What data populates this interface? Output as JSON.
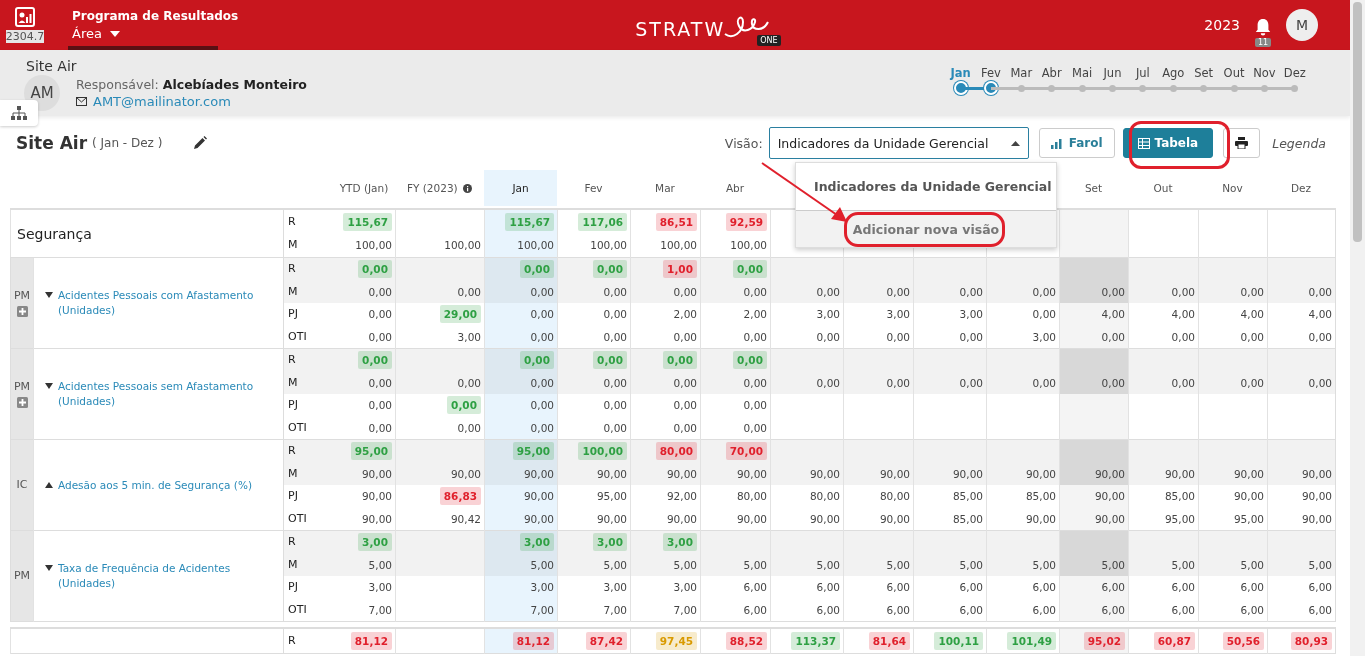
{
  "app_bar": {
    "badge_code": "2304.7",
    "program": "Programa de Resultados",
    "area": "Área",
    "logo_text": "STRATW",
    "logo_suffix": "ONE",
    "year": "2023",
    "notifications": "11",
    "user_initial": "M"
  },
  "unit": {
    "name": "Site Air",
    "initials": "AM",
    "responsible_label": "Responsável:",
    "responsible": "Alcebíades Monteiro",
    "email": "AMT@mailinator.com"
  },
  "months": [
    {
      "label": "Jan",
      "selected": true,
      "in_range": true
    },
    {
      "label": "Fev",
      "selected": false,
      "in_range": true
    },
    {
      "label": "Mar",
      "selected": false,
      "in_range": false
    },
    {
      "label": "Abr",
      "selected": false,
      "in_range": false
    },
    {
      "label": "Mai",
      "selected": false,
      "in_range": false
    },
    {
      "label": "Jun",
      "selected": false,
      "in_range": false
    },
    {
      "label": "Jul",
      "selected": false,
      "in_range": false
    },
    {
      "label": "Ago",
      "selected": false,
      "in_range": false
    },
    {
      "label": "Set",
      "selected": false,
      "in_range": false
    },
    {
      "label": "Out",
      "selected": false,
      "in_range": false
    },
    {
      "label": "Nov",
      "selected": false,
      "in_range": false
    },
    {
      "label": "Dez",
      "selected": false,
      "in_range": false
    }
  ],
  "title": {
    "name": "Site Air",
    "period": "( Jan - Dez )"
  },
  "toolbar": {
    "view_label": "Visão:",
    "view_value": "Indicadores da Unidade Gerencial",
    "buttons": [
      {
        "label": "Farol",
        "selected": false
      },
      {
        "label": "Tabela",
        "selected": true
      }
    ],
    "legend": "Legenda"
  },
  "view_menu": {
    "options": [
      "Indicadores da Unidade Gerencial"
    ],
    "add_option": "Adicionar nova visão"
  },
  "columns": [
    {
      "label": "YTD (Jan)",
      "selected": false,
      "shaded": false,
      "info": false
    },
    {
      "label": "FY (2023)",
      "selected": false,
      "shaded": false,
      "info": true
    },
    {
      "label": "Jan",
      "selected": true,
      "shaded": false,
      "info": false
    },
    {
      "label": "Fev",
      "selected": false,
      "shaded": false,
      "info": false
    },
    {
      "label": "Mar",
      "selected": false,
      "shaded": false,
      "info": false
    },
    {
      "label": "Abr",
      "selected": false,
      "shaded": false,
      "info": false
    },
    {
      "shaded": false
    },
    {
      "shaded": false
    },
    {
      "shaded": false
    },
    {
      "shaded": false
    },
    {
      "label": "Set",
      "selected": false,
      "shaded": true,
      "info": false
    },
    {
      "label": "Out",
      "selected": false,
      "shaded": false,
      "info": false
    },
    {
      "label": "Nov",
      "selected": false,
      "shaded": false,
      "info": false
    },
    {
      "label": "Dez",
      "selected": false,
      "shaded": false,
      "info": false
    }
  ],
  "section": {
    "title": "Segurança",
    "rows": [
      {
        "type": "R",
        "shaded": false,
        "cells": [
          {
            "text": "115,67",
            "color": "#2ea043"
          },
          null,
          {
            "text": "115,67",
            "color": "#2ea043"
          },
          {
            "text": "117,06",
            "color": "#2ea043"
          },
          {
            "text": "86,51",
            "color": "#e0202c"
          },
          {
            "text": "92,59",
            "color": "#e0202c"
          },
          null,
          null,
          null,
          null,
          null,
          null,
          null,
          null
        ]
      },
      {
        "type": "M",
        "shaded": false,
        "cells": [
          "100,00",
          "100,00",
          "100,00",
          "100,00",
          "100,00",
          "100,00",
          null,
          null,
          null,
          null,
          null,
          null,
          null,
          null
        ]
      }
    ]
  },
  "indicators": [
    {
      "code": "PM",
      "addable": true,
      "expanded": true,
      "name": "Acidentes Pessoais com Afastamento (Unidades)",
      "rows": [
        {
          "type": "R",
          "shaded": true,
          "cells": [
            {
              "text": "0,00",
              "color": "#2ea043"
            },
            null,
            {
              "text": "0,00",
              "color": "#2ea043"
            },
            {
              "text": "0,00",
              "color": "#2ea043"
            },
            {
              "text": "1,00",
              "color": "#e0202c"
            },
            {
              "text": "0,00",
              "color": "#2ea043"
            },
            null,
            null,
            null,
            null,
            null,
            null,
            null,
            null
          ]
        },
        {
          "type": "M",
          "shaded": true,
          "cells": [
            "0,00",
            "0,00",
            "0,00",
            "0,00",
            "0,00",
            "0,00",
            "0,00",
            "0,00",
            "0,00",
            "0,00",
            "0,00",
            "0,00",
            "0,00",
            "0,00"
          ]
        },
        {
          "type": "PJ",
          "shaded": false,
          "cells": [
            "0,00",
            {
              "text": "29,00",
              "color": "#2ea043"
            },
            "0,00",
            "0,00",
            "2,00",
            "2,00",
            "3,00",
            "3,00",
            "3,00",
            "0,00",
            "4,00",
            "4,00",
            "4,00",
            "4,00"
          ]
        },
        {
          "type": "OTI",
          "shaded": false,
          "cells": [
            "0,00",
            "3,00",
            "0,00",
            "0,00",
            "0,00",
            "0,00",
            "0,00",
            "0,00",
            "0,00",
            "3,00",
            "0,00",
            "0,00",
            "0,00",
            "0,00"
          ]
        }
      ]
    },
    {
      "code": "PM",
      "addable": true,
      "expanded": true,
      "name": "Acidentes Pessoais sem Afastamento (Unidades)",
      "rows": [
        {
          "type": "R",
          "shaded": true,
          "cells": [
            {
              "text": "0,00",
              "color": "#2ea043"
            },
            null,
            {
              "text": "0,00",
              "color": "#2ea043"
            },
            {
              "text": "0,00",
              "color": "#2ea043"
            },
            {
              "text": "0,00",
              "color": "#2ea043"
            },
            {
              "text": "0,00",
              "color": "#2ea043"
            },
            null,
            null,
            null,
            null,
            null,
            null,
            null,
            null
          ]
        },
        {
          "type": "M",
          "shaded": true,
          "cells": [
            "0,00",
            "0,00",
            "0,00",
            "0,00",
            "0,00",
            "0,00",
            "0,00",
            "0,00",
            "0,00",
            "0,00",
            "0,00",
            "0,00",
            "0,00",
            "0,00"
          ]
        },
        {
          "type": "PJ",
          "shaded": false,
          "cells": [
            "0,00",
            {
              "text": "0,00",
              "color": "#2ea043"
            },
            "0,00",
            "0,00",
            "0,00",
            "0,00",
            null,
            null,
            null,
            null,
            null,
            null,
            null,
            null
          ]
        },
        {
          "type": "OTI",
          "shaded": false,
          "cells": [
            "0,00",
            "0,00",
            "0,00",
            "0,00",
            "0,00",
            "0,00",
            null,
            null,
            null,
            null,
            null,
            null,
            null,
            null
          ]
        }
      ]
    },
    {
      "code": "IC",
      "addable": false,
      "expanded": false,
      "name": "Adesão aos 5 min. de Segurança (%)",
      "rows": [
        {
          "type": "R",
          "shaded": true,
          "cells": [
            {
              "text": "95,00",
              "color": "#2ea043"
            },
            null,
            {
              "text": "95,00",
              "color": "#2ea043"
            },
            {
              "text": "100,00",
              "color": "#2ea043"
            },
            {
              "text": "80,00",
              "color": "#e0202c"
            },
            {
              "text": "70,00",
              "color": "#e0202c"
            },
            null,
            null,
            null,
            null,
            null,
            null,
            null,
            null
          ]
        },
        {
          "type": "M",
          "shaded": true,
          "cells": [
            "90,00",
            "90,00",
            "90,00",
            "90,00",
            "90,00",
            "90,00",
            "90,00",
            "90,00",
            "90,00",
            "90,00",
            "90,00",
            "90,00",
            "90,00",
            "90,00"
          ]
        },
        {
          "type": "PJ",
          "shaded": false,
          "cells": [
            "90,00",
            {
              "text": "86,83",
              "color": "#e0202c"
            },
            "90,00",
            "95,00",
            "92,00",
            "80,00",
            "80,00",
            "80,00",
            "85,00",
            "85,00",
            "90,00",
            "85,00",
            "90,00",
            "90,00"
          ]
        },
        {
          "type": "OTI",
          "shaded": false,
          "cells": [
            "90,00",
            "90,42",
            "90,00",
            "90,00",
            "90,00",
            "90,00",
            "90,00",
            "90,00",
            "85,00",
            "90,00",
            "90,00",
            "95,00",
            "95,00",
            "90,00"
          ]
        }
      ]
    },
    {
      "code": "PM",
      "addable": false,
      "expanded": true,
      "name": "Taxa de Frequência de Acidentes (Unidades)",
      "rows": [
        {
          "type": "R",
          "shaded": true,
          "cells": [
            {
              "text": "3,00",
              "color": "#2ea043"
            },
            null,
            {
              "text": "3,00",
              "color": "#2ea043"
            },
            {
              "text": "3,00",
              "color": "#2ea043"
            },
            {
              "text": "3,00",
              "color": "#2ea043"
            },
            null,
            null,
            null,
            null,
            null,
            null,
            null,
            null,
            null
          ]
        },
        {
          "type": "M",
          "shaded": true,
          "cells": [
            "5,00",
            null,
            "5,00",
            "5,00",
            "5,00",
            "5,00",
            "5,00",
            "5,00",
            "5,00",
            "5,00",
            "5,00",
            "5,00",
            "5,00",
            "5,00"
          ]
        },
        {
          "type": "PJ",
          "shaded": false,
          "cells": [
            "3,00",
            null,
            "3,00",
            "3,00",
            "3,00",
            "6,00",
            "6,00",
            "6,00",
            "6,00",
            "6,00",
            "6,00",
            "6,00",
            "6,00",
            "6,00"
          ]
        },
        {
          "type": "OTI",
          "shaded": false,
          "cells": [
            "7,00",
            null,
            "7,00",
            "7,00",
            "7,00",
            "6,00",
            "6,00",
            "6,00",
            "6,00",
            "6,00",
            "6,00",
            "6,00",
            "6,00",
            "6,00"
          ]
        }
      ]
    }
  ],
  "next_section": {
    "rows": [
      {
        "type": "R",
        "shaded": false,
        "cells": [
          {
            "text": "81,12",
            "color": "#e0202c"
          },
          null,
          {
            "text": "81,12",
            "color": "#e0202c"
          },
          {
            "text": "87,42",
            "color": "#e0202c"
          },
          {
            "text": "97,45",
            "color": "#d99a00"
          },
          {
            "text": "88,52",
            "color": "#e0202c"
          },
          {
            "text": "113,37",
            "color": "#2ea043"
          },
          {
            "text": "81,64",
            "color": "#e0202c"
          },
          {
            "text": "100,11",
            "color": "#2ea043"
          },
          {
            "text": "101,49",
            "color": "#2ea043"
          },
          {
            "text": "95,02",
            "color": "#e0202c"
          },
          {
            "text": "60,87",
            "color": "#e0202c"
          },
          {
            "text": "50,56",
            "color": "#e0202c"
          },
          {
            "text": "80,93",
            "color": "#e0202c"
          }
        ]
      }
    ]
  }
}
